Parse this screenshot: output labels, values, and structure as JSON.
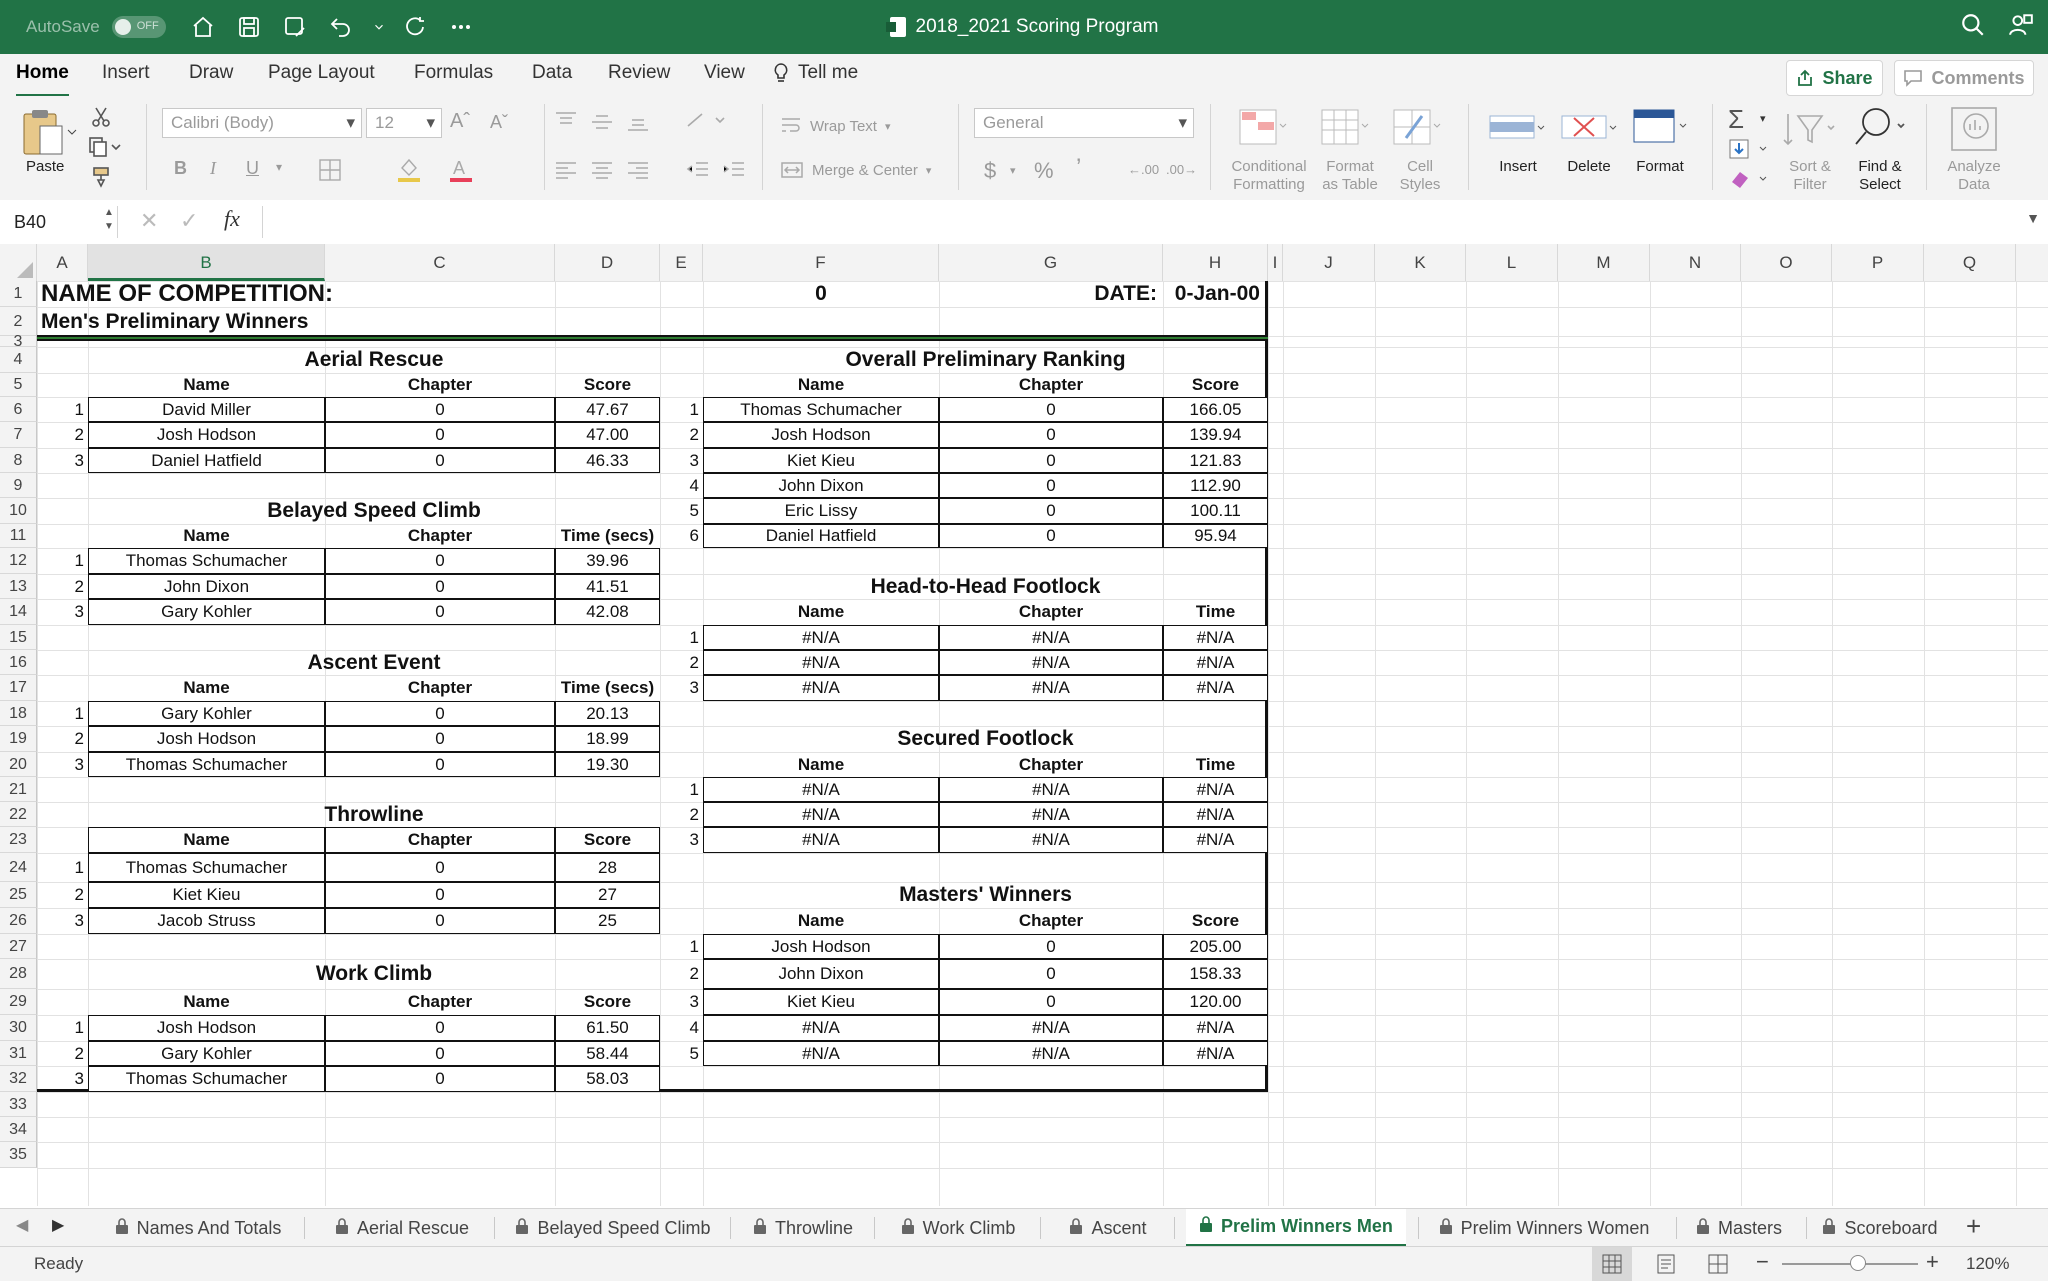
{
  "titlebar": {
    "autosave_label": "AutoSave",
    "autosave_state": "OFF",
    "document_title": "2018_2021 Scoring Program"
  },
  "menu": {
    "tabs": [
      "Home",
      "Insert",
      "Draw",
      "Page Layout",
      "Formulas",
      "Data",
      "Review",
      "View"
    ],
    "active": "Home",
    "tell_me": "Tell me",
    "share": "Share",
    "comments": "Comments"
  },
  "ribbon": {
    "paste": "Paste",
    "font_name": "Calibri (Body)",
    "font_size": "12",
    "wrap_text": "Wrap Text",
    "merge_center": "Merge & Center",
    "number_format": "General",
    "conditional_formatting": "Conditional\nFormatting",
    "format_as_table": "Format\nas Table",
    "cell_styles": "Cell\nStyles",
    "insert": "Insert",
    "delete": "Delete",
    "format": "Format",
    "sort_filter": "Sort &\nFilter",
    "find_select": "Find &\nSelect",
    "analyze_data": "Analyze\nData"
  },
  "formula_bar": {
    "name_box": "B40",
    "fx": "fx",
    "value": ""
  },
  "columns": [
    "A",
    "B",
    "C",
    "D",
    "E",
    "F",
    "G",
    "H",
    "I",
    "J",
    "K",
    "L",
    "M",
    "N",
    "O",
    "P",
    "Q"
  ],
  "selected_column": "B",
  "rows": [
    "1",
    "2",
    "3",
    "4",
    "5",
    "6",
    "7",
    "8",
    "9",
    "10",
    "11",
    "12",
    "13",
    "14",
    "15",
    "16",
    "17",
    "18",
    "19",
    "20",
    "21",
    "22",
    "23",
    "24",
    "25",
    "26",
    "27",
    "28",
    "29",
    "30",
    "31",
    "32",
    "33",
    "34",
    "35"
  ],
  "sheet": {
    "competition_label": "NAME OF COMPETITION:",
    "competition_value": "0",
    "date_label": "DATE:",
    "date_value": "0-Jan-00",
    "subtitle": "Men's Preliminary Winners",
    "aerial_rescue": {
      "title": "Aerial Rescue",
      "headers": [
        "Name",
        "Chapter",
        "Score"
      ],
      "rows": [
        {
          "rank": "1",
          "name": "David Miller",
          "chapter": "0",
          "value": "47.67"
        },
        {
          "rank": "2",
          "name": "Josh Hodson",
          "chapter": "0",
          "value": "47.00"
        },
        {
          "rank": "3",
          "name": "Daniel Hatfield",
          "chapter": "0",
          "value": "46.33"
        }
      ]
    },
    "belayed_speed_climb": {
      "title": "Belayed Speed Climb",
      "headers": [
        "Name",
        "Chapter",
        "Time (secs)"
      ],
      "rows": [
        {
          "rank": "1",
          "name": "Thomas Schumacher",
          "chapter": "0",
          "value": "39.96"
        },
        {
          "rank": "2",
          "name": "John Dixon",
          "chapter": "0",
          "value": "41.51"
        },
        {
          "rank": "3",
          "name": "Gary Kohler",
          "chapter": "0",
          "value": "42.08"
        }
      ]
    },
    "ascent_event": {
      "title": "Ascent Event",
      "headers": [
        "Name",
        "Chapter",
        "Time (secs)"
      ],
      "rows": [
        {
          "rank": "1",
          "name": "Gary Kohler",
          "chapter": "0",
          "value": "20.13"
        },
        {
          "rank": "2",
          "name": "Josh Hodson",
          "chapter": "0",
          "value": "18.99"
        },
        {
          "rank": "3",
          "name": "Thomas Schumacher",
          "chapter": "0",
          "value": "19.30"
        }
      ]
    },
    "throwline": {
      "title": "Throwline",
      "headers": [
        "Name",
        "Chapter",
        "Score"
      ],
      "rows": [
        {
          "rank": "1",
          "name": "Thomas Schumacher",
          "chapter": "0",
          "value": "28"
        },
        {
          "rank": "2",
          "name": "Kiet Kieu",
          "chapter": "0",
          "value": "27"
        },
        {
          "rank": "3",
          "name": "Jacob Struss",
          "chapter": "0",
          "value": "25"
        }
      ]
    },
    "work_climb": {
      "title": "Work Climb",
      "headers": [
        "Name",
        "Chapter",
        "Score"
      ],
      "rows": [
        {
          "rank": "1",
          "name": "Josh Hodson",
          "chapter": "0",
          "value": "61.50"
        },
        {
          "rank": "2",
          "name": "Gary Kohler",
          "chapter": "0",
          "value": "58.44"
        },
        {
          "rank": "3",
          "name": "Thomas Schumacher",
          "chapter": "0",
          "value": "58.03"
        }
      ]
    },
    "overall_ranking": {
      "title": "Overall Preliminary Ranking",
      "headers": [
        "Name",
        "Chapter",
        "Score"
      ],
      "rows": [
        {
          "rank": "1",
          "name": "Thomas Schumacher",
          "chapter": "0",
          "value": "166.05"
        },
        {
          "rank": "2",
          "name": "Josh Hodson",
          "chapter": "0",
          "value": "139.94"
        },
        {
          "rank": "3",
          "name": "Kiet Kieu",
          "chapter": "0",
          "value": "121.83"
        },
        {
          "rank": "4",
          "name": "John Dixon",
          "chapter": "0",
          "value": "112.90"
        },
        {
          "rank": "5",
          "name": "Eric Lissy",
          "chapter": "0",
          "value": "100.11"
        },
        {
          "rank": "6",
          "name": "Daniel Hatfield",
          "chapter": "0",
          "value": "95.94"
        }
      ]
    },
    "head_to_head": {
      "title": "Head-to-Head Footlock",
      "headers": [
        "Name",
        "Chapter",
        "Time"
      ],
      "rows": [
        {
          "rank": "1",
          "name": "#N/A",
          "chapter": "#N/A",
          "value": "#N/A"
        },
        {
          "rank": "2",
          "name": "#N/A",
          "chapter": "#N/A",
          "value": "#N/A"
        },
        {
          "rank": "3",
          "name": "#N/A",
          "chapter": "#N/A",
          "value": "#N/A"
        }
      ]
    },
    "secured_footlock": {
      "title": "Secured Footlock",
      "headers": [
        "Name",
        "Chapter",
        "Time"
      ],
      "rows": [
        {
          "rank": "1",
          "name": "#N/A",
          "chapter": "#N/A",
          "value": "#N/A"
        },
        {
          "rank": "2",
          "name": "#N/A",
          "chapter": "#N/A",
          "value": "#N/A"
        },
        {
          "rank": "3",
          "name": "#N/A",
          "chapter": "#N/A",
          "value": "#N/A"
        }
      ]
    },
    "masters_winners": {
      "title": "Masters' Winners",
      "headers": [
        "Name",
        "Chapter",
        "Score"
      ],
      "rows": [
        {
          "rank": "1",
          "name": "Josh Hodson",
          "chapter": "0",
          "value": "205.00"
        },
        {
          "rank": "2",
          "name": "John Dixon",
          "chapter": "0",
          "value": "158.33"
        },
        {
          "rank": "3",
          "name": "Kiet Kieu",
          "chapter": "0",
          "value": "120.00"
        },
        {
          "rank": "4",
          "name": "#N/A",
          "chapter": "#N/A",
          "value": "#N/A"
        },
        {
          "rank": "5",
          "name": "#N/A",
          "chapter": "#N/A",
          "value": "#N/A"
        }
      ]
    }
  },
  "sheet_tabs": [
    "Names And Totals",
    "Aerial Rescue",
    "Belayed Speed Climb",
    "Throwline",
    "Work Climb",
    "Ascent",
    "Prelim Winners Men",
    "Prelim Winners Women",
    "Masters",
    "Scoreboard"
  ],
  "active_sheet_tab": "Prelim Winners Men",
  "status": {
    "ready": "Ready",
    "zoom": "120%"
  },
  "colors": {
    "excel_green": "#217346",
    "header_gray": "#f3f3f3"
  }
}
